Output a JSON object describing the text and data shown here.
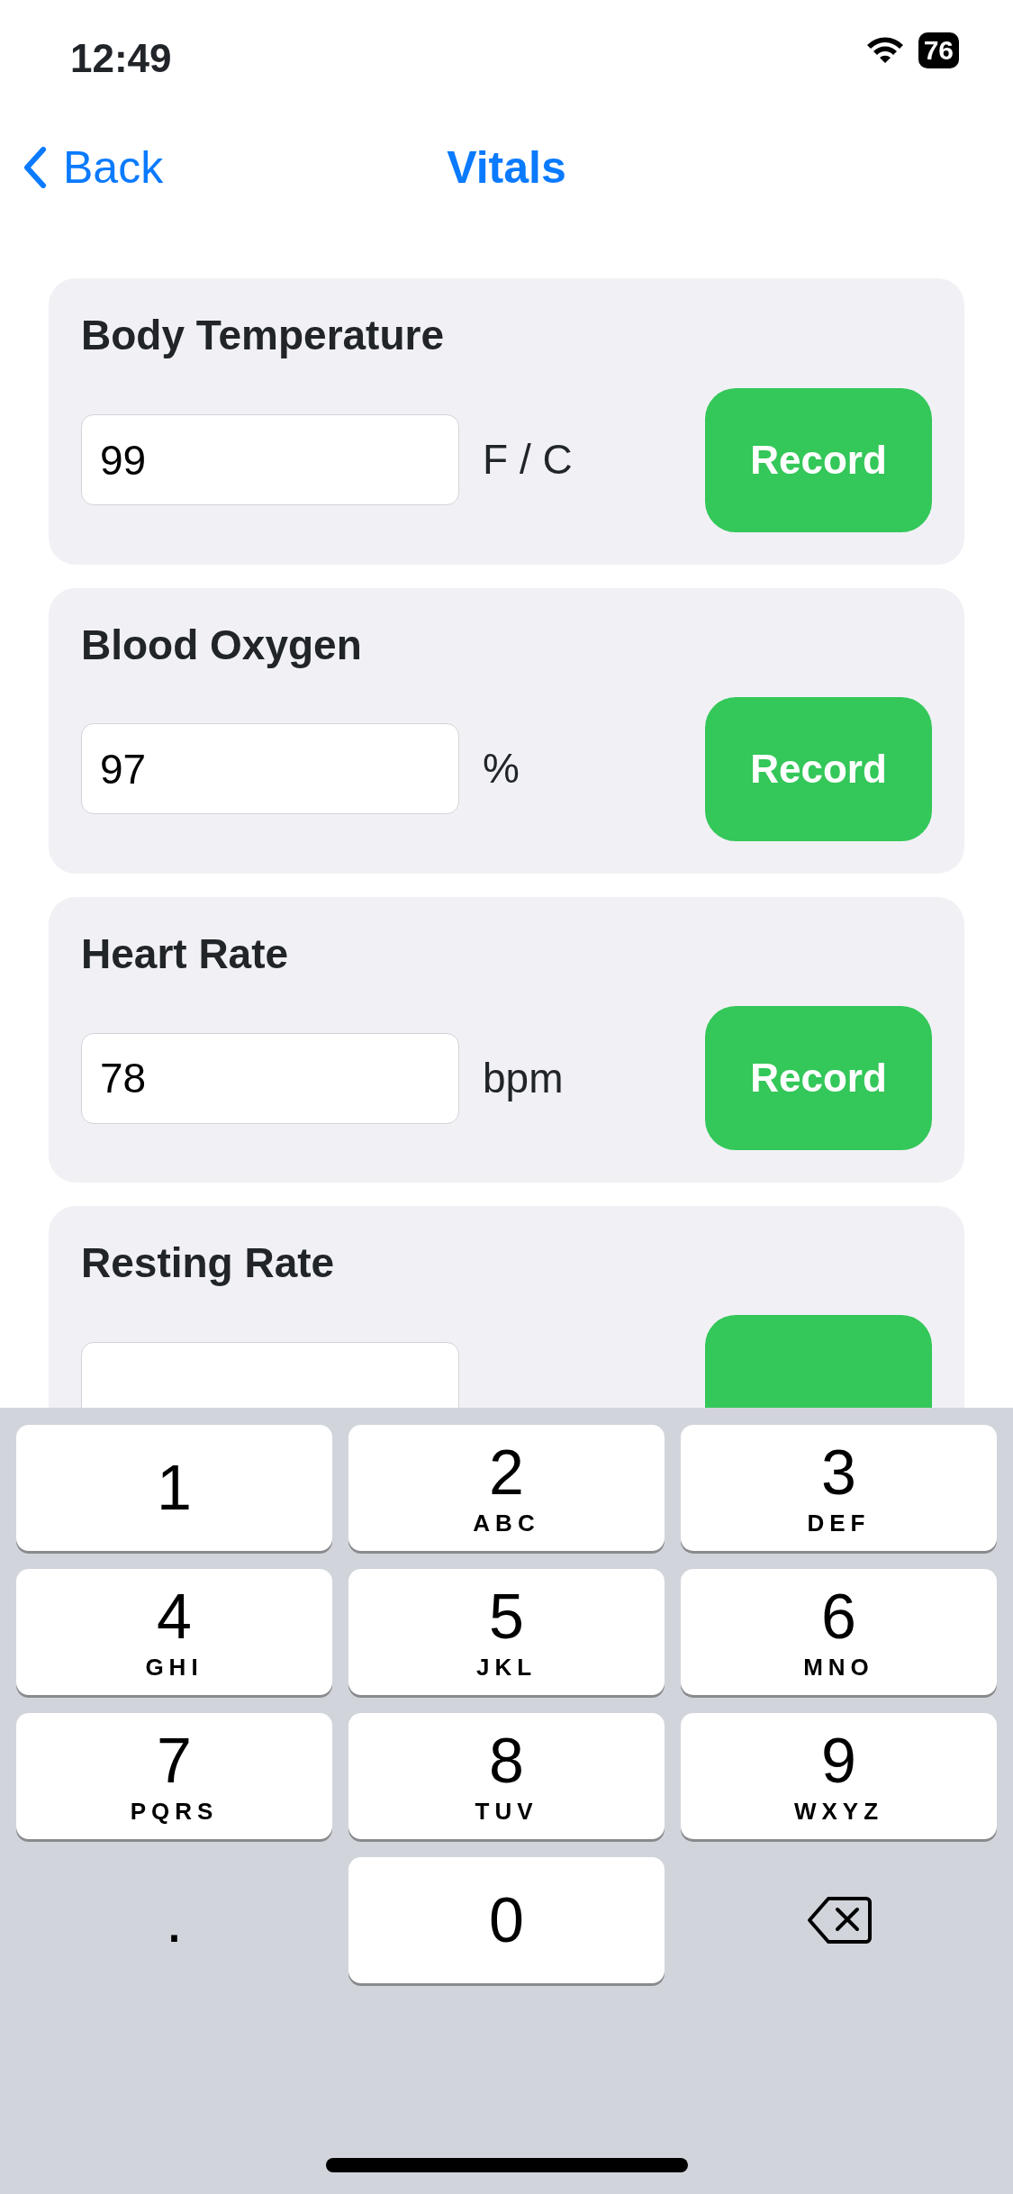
{
  "status_bar": {
    "time": "12:49",
    "battery": "76"
  },
  "nav": {
    "back": "Back",
    "title": "Vitals"
  },
  "vitals": [
    {
      "label": "Body Temperature",
      "value": "99",
      "unit": "F / C",
      "button": "Record"
    },
    {
      "label": "Blood Oxygen",
      "value": "97",
      "unit": "%",
      "button": "Record"
    },
    {
      "label": "Heart Rate",
      "value": "78",
      "unit": "bpm",
      "button": "Record"
    },
    {
      "label": "Resting Rate"
    }
  ],
  "keypad": [
    {
      "kind": "digit",
      "digit": "1"
    },
    {
      "kind": "digit",
      "digit": "2",
      "letters": "ABC"
    },
    {
      "kind": "digit",
      "digit": "3",
      "letters": "DEF"
    },
    {
      "kind": "digit",
      "digit": "4",
      "letters": "GHI"
    },
    {
      "kind": "digit",
      "digit": "5",
      "letters": "JKL"
    },
    {
      "kind": "digit",
      "digit": "6",
      "letters": "MNO"
    },
    {
      "kind": "digit",
      "digit": "7",
      "letters": "PQRS"
    },
    {
      "kind": "digit",
      "digit": "8",
      "letters": "TUV"
    },
    {
      "kind": "digit",
      "digit": "9",
      "letters": "WXYZ"
    },
    {
      "kind": "plain",
      "digit": "."
    },
    {
      "kind": "digit",
      "digit": "0"
    },
    {
      "kind": "delete"
    }
  ]
}
